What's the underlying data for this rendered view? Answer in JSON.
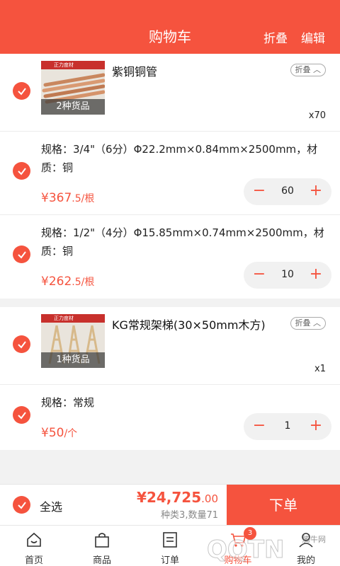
{
  "header": {
    "title": "购物车",
    "fold": "折叠",
    "edit": "编辑"
  },
  "colors": {
    "accent": "#f5533e"
  },
  "groups": [
    {
      "name": "紫铜铜管",
      "fold_label": "折叠",
      "thumb_brand": "正力度材",
      "thumb_caption": "2种货品",
      "qty_text": "x70",
      "specs": [
        {
          "text": "规格：3/4\"（6分）Φ22.2mm×0.84mm×2500mm，材质：铜",
          "price_int": "¥367",
          "price_dec": ".5/根",
          "qty": "60"
        },
        {
          "text": "规格：1/2\"（4分）Φ15.85mm×0.74mm×2500mm，材质：铜",
          "price_int": "¥262",
          "price_dec": ".5/根",
          "qty": "10"
        }
      ]
    },
    {
      "name": "KG常规架梯(30×50mm木方)",
      "fold_label": "折叠",
      "thumb_brand": "正力度材",
      "thumb_caption": "1种货品",
      "qty_text": "x1",
      "specs": [
        {
          "text": "规格：常规",
          "price_int": "¥50",
          "price_dec": "/个",
          "qty": "1"
        }
      ]
    }
  ],
  "footer": {
    "select_all": "全选",
    "total_int": "¥24,725",
    "total_dec": ".00",
    "kinds": "种类3,数量71",
    "order_button": "下单"
  },
  "tabs": [
    {
      "label": "首页",
      "icon": "home-icon"
    },
    {
      "label": "商品",
      "icon": "bag-icon"
    },
    {
      "label": "订单",
      "icon": "list-icon"
    },
    {
      "label": "购物车",
      "icon": "cart-icon",
      "badge": "3"
    },
    {
      "label": "我的",
      "icon": "user-icon"
    }
  ],
  "watermark": {
    "site": "腾牛网",
    "logo": "QQTN"
  }
}
